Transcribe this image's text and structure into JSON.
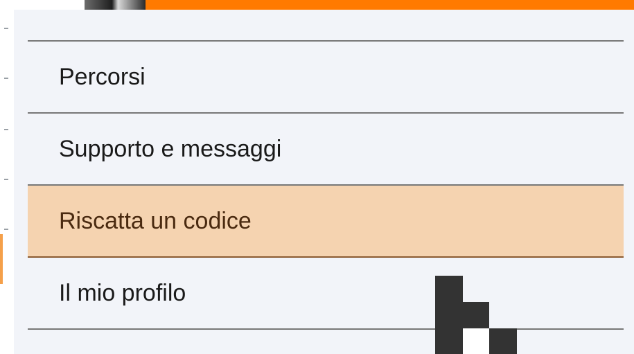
{
  "menu": {
    "items": [
      {
        "label": "Percorsi",
        "highlighted": false
      },
      {
        "label": "Supporto e messaggi",
        "highlighted": false
      },
      {
        "label": "Riscatta un codice",
        "highlighted": true
      },
      {
        "label": "Il mio profilo",
        "highlighted": false
      }
    ],
    "highlight_color": "#f5d3b0",
    "panel_color": "#f2f4f9"
  },
  "header": {
    "accent_color": "#ff7a00"
  },
  "cursor": {
    "icon": "pointer-cursor-icon"
  }
}
